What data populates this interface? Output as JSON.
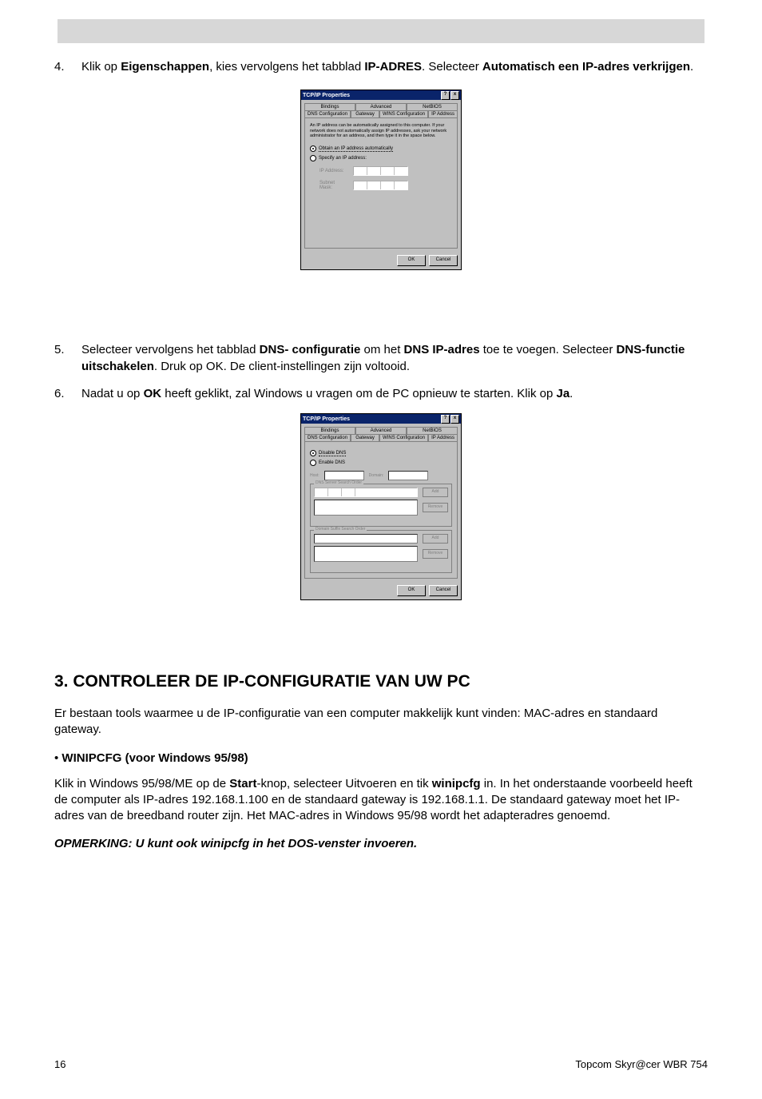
{
  "steps": {
    "s4": {
      "num": "4.",
      "pre": "Klik op ",
      "b1": "Eigenschappen",
      "mid1": ", kies vervolgens het tabblad ",
      "b2": "IP-ADRES",
      "mid2": ". Selecteer ",
      "b3": "Automatisch een IP-adres verkrijgen",
      "post": "."
    },
    "s5": {
      "num": "5.",
      "pre": "Selecteer vervolgens  het tabblad ",
      "b1": "DNS- configuratie",
      "mid1": " om het ",
      "b2": "DNS IP-adres",
      "mid2": " toe te voegen. Selecteer ",
      "b3": "DNS-functie uitschakelen",
      "post": ". Druk op OK. De client-instellingen zijn voltooid."
    },
    "s6": {
      "num": "6.",
      "pre": "Nadat u op ",
      "b1": "OK",
      "mid1": " heeft geklikt, zal Windows u vragen om de PC opnieuw te starten. Klik op ",
      "b2": "Ja",
      "post": "."
    }
  },
  "dialog1": {
    "title": "TCP/IP Properties",
    "help": "?",
    "close": "x",
    "tabs_row1": {
      "t1": "Bindings",
      "t2": "Advanced",
      "t3": "NetBIOS"
    },
    "tabs_row2": {
      "t1": "DNS Configuration",
      "t2": "Gateway",
      "t3": "WINS Configuration",
      "t4": "IP Address"
    },
    "desc": "An IP address can be automatically assigned to this computer. If your network does not automatically assign IP addresses, ask your network administrator for an address, and then type it in the space below.",
    "opt1": "Obtain an IP address automatically",
    "opt2": "Specify an IP address:",
    "ip_label": "IP Address:",
    "mask_label": "Subnet Mask:",
    "ok": "OK",
    "cancel": "Cancel"
  },
  "dialog2": {
    "title": "TCP/IP Properties",
    "help": "?",
    "close": "x",
    "tabs_row1": {
      "t1": "Bindings",
      "t2": "Advanced",
      "t3": "NetBIOS"
    },
    "tabs_row2": {
      "t1": "DNS Configuration",
      "t2": "Gateway",
      "t3": "WINS Configuration",
      "t4": "IP Address"
    },
    "opt1": "Disable DNS",
    "opt2": "Enable DNS",
    "host": "Host:",
    "domain": "Domain:",
    "legend1": "DNS Server Search Order",
    "legend2": "Domain Suffix Search Order",
    "add": "Add",
    "remove": "Remove",
    "ok": "OK",
    "cancel": "Cancel"
  },
  "section": {
    "heading": "3.  CONTROLEER DE IP-CONFIGURATIE VAN UW PC",
    "p1": "Er bestaan tools waarmee u de IP-configuratie van een computer makkelijk kunt vinden: MAC-adres en standaard gateway.",
    "bullet_dot": "•",
    "bullet": " WINIPCFG (voor Windows 95/98)",
    "p2_pre": "Klik in Windows 95/98/ME op de ",
    "p2_b1": "Start",
    "p2_mid1": "-knop, selecteer Uitvoeren en tik ",
    "p2_b2": "winipcfg",
    "p2_post": " in. In het onderstaande voorbeeld heeft de computer als IP-adres 192.168.1.100 en de standaard gateway is 192.168.1.1. De standaard gateway moet het IP-adres van de breedband router zijn. Het MAC-adres in Windows 95/98 wordt het adapteradres genoemd.",
    "note": "OPMERKING: U kunt ook winipcfg in het DOS-venster invoeren."
  },
  "footer": {
    "page": "16",
    "product": "Topcom Skyr@cer WBR 754"
  }
}
